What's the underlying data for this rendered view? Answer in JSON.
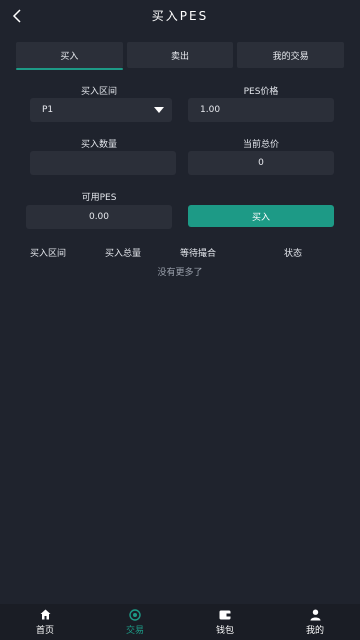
{
  "header": {
    "title": "买入PES",
    "back_icon": "chevron-left-icon"
  },
  "tabs": [
    {
      "label": "买入",
      "active": true
    },
    {
      "label": "卖出",
      "active": false
    },
    {
      "label": "我的交易",
      "active": false
    }
  ],
  "form": {
    "interval_label": "买入区间",
    "interval_value": "P1",
    "price_label": "PES价格",
    "price_value": "1.00",
    "quantity_label": "买入数量",
    "quantity_value": "",
    "total_label": "当前总价",
    "total_value": "0",
    "available_label": "可用PES",
    "available_value": "0.00",
    "buy_button_label": "买入"
  },
  "table": {
    "headers": [
      "买入区间",
      "买入总量",
      "等待撮合",
      "状态"
    ],
    "empty_text": "没有更多了"
  },
  "bottom_nav": [
    {
      "label": "首页",
      "icon": "home-icon",
      "active": false
    },
    {
      "label": "交易",
      "icon": "trade-icon",
      "active": true
    },
    {
      "label": "钱包",
      "icon": "wallet-icon",
      "active": false
    },
    {
      "label": "我的",
      "icon": "user-icon",
      "active": false
    }
  ],
  "colors": {
    "background": "#1f232d",
    "panel": "#2b2f39",
    "accent": "#1d9a86",
    "nav_background": "#1a1d25"
  }
}
